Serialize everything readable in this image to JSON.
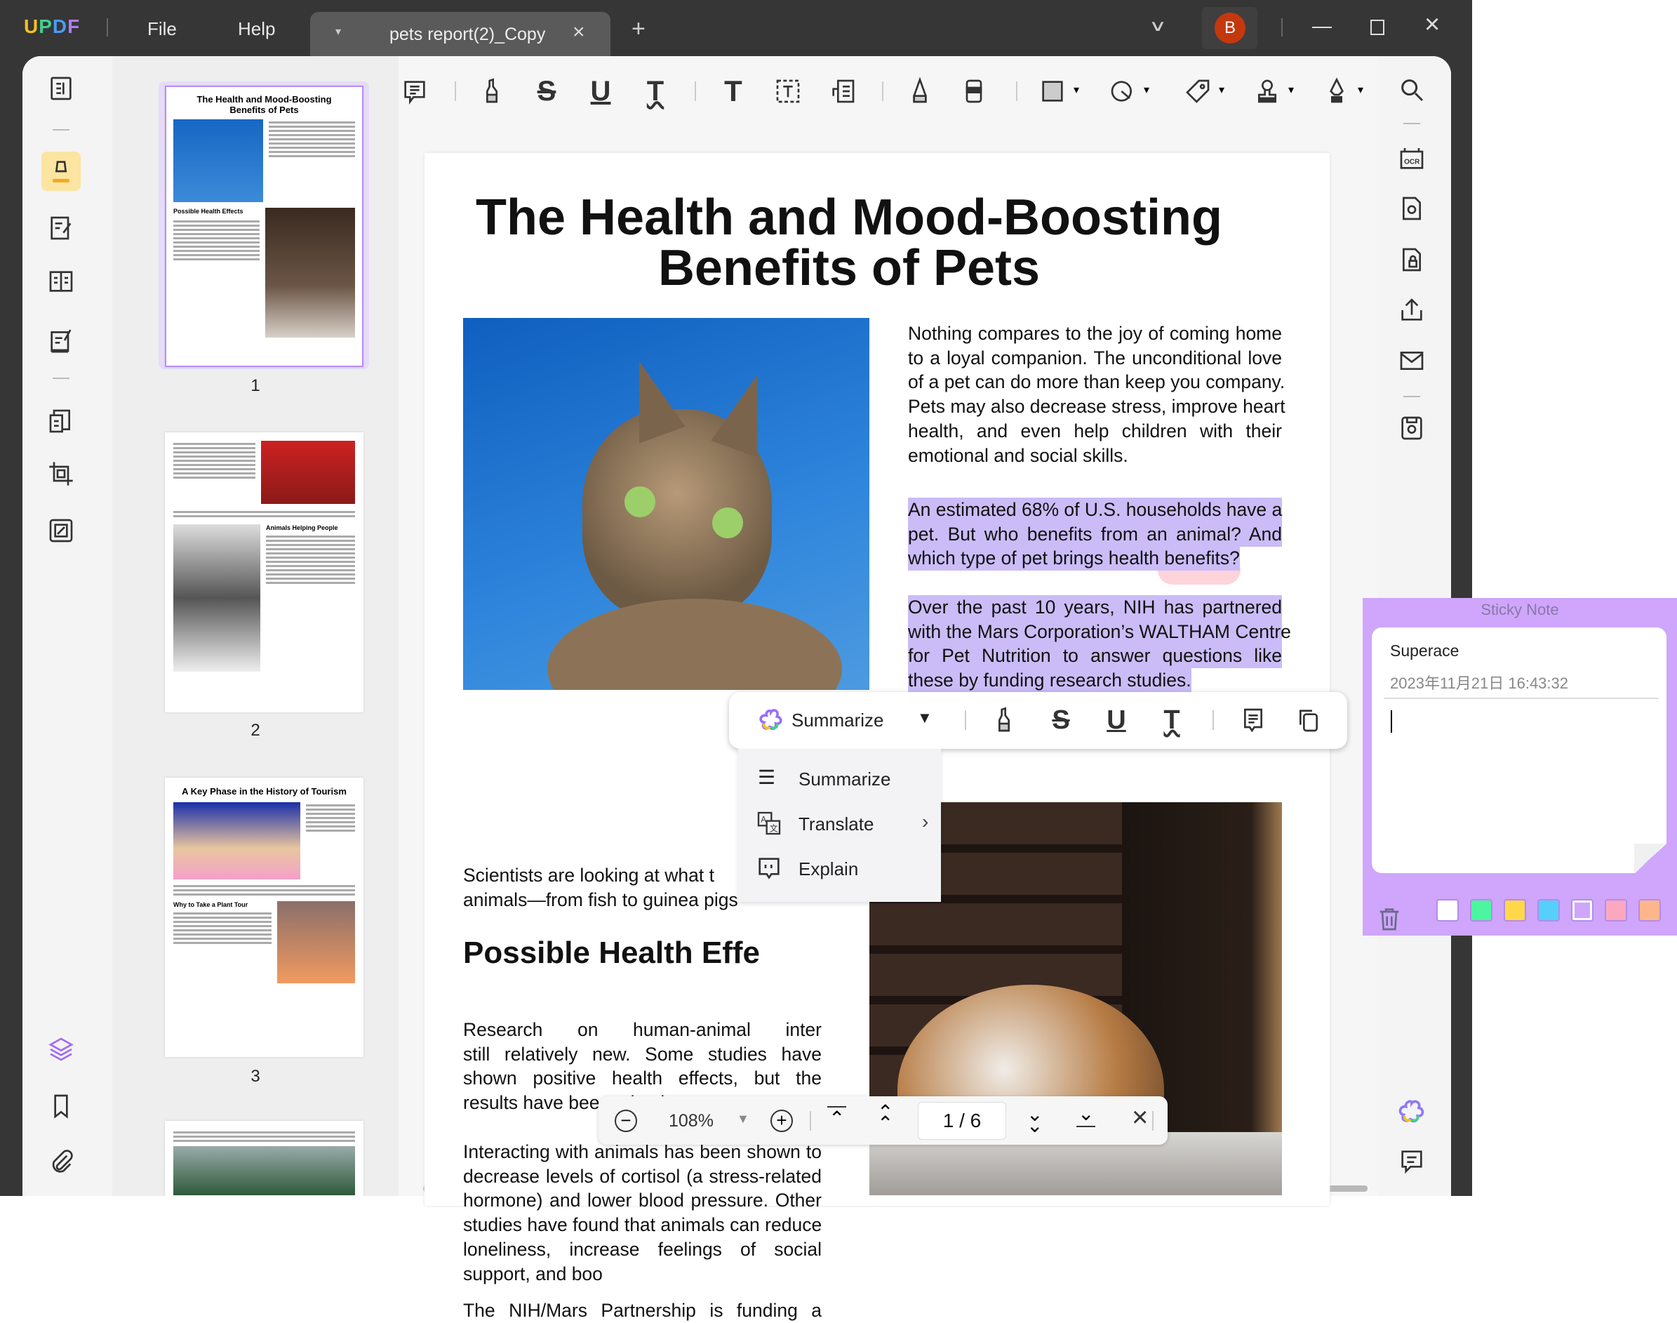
{
  "titlebar": {
    "logo": "UPDF",
    "menu_file": "File",
    "menu_help": "Help",
    "tab_title": "pets report(2)_Copy",
    "avatar_initial": "B"
  },
  "colors": {
    "accent": "#a06bf5",
    "highlight": "#cbbcf7",
    "sticky_bg": "#cfa6fb",
    "avatar": "#c4380e"
  },
  "thumbnails": [
    {
      "page": "1",
      "title": "The Health and Mood-Boosting Benefits of Pets",
      "subtitle": "Possible Health Effects"
    },
    {
      "page": "2",
      "subtitle": "Animals Helping People"
    },
    {
      "page": "3",
      "title": "A Key Phase in the History of Tourism",
      "subtitle": "Why to Take a Plant Tour"
    }
  ],
  "doc": {
    "title_line1": "The Health and Mood-Boosting",
    "title_line2": "Benefits of Pets",
    "intro_lines": [
      "Nothing compares to the joy of coming home",
      "to a loyal companion. The unconditional love",
      "of a pet can do more than keep you company.",
      "Pets may also decrease stress, improve heart",
      "health, and even help children with their",
      "emotional and social skills."
    ],
    "hl1_lines": [
      "An estimated 68% of U.S. households have a",
      "pet. But who benefits from an animal? And",
      "which type of pet brings health benefits?"
    ],
    "hl2_lines": [
      "Over the past 10 years, NIH has partnered",
      "with the Mars Corporation’s WALTHAM Centre",
      "for Pet Nutrition to answer questions like",
      "these by funding research studies."
    ],
    "sci_lines": [
      "Scientists are looking at what t",
      "animals—from fish to guinea pigs"
    ],
    "heading": "Possible Health Effe",
    "research_lines": [
      "Research on human-animal inter",
      "still relatively new. Some studies have",
      "shown positive health effects, but the",
      "results have been mixed."
    ],
    "interact_lines": [
      "Interacting with animals has been shown to",
      "decrease levels of cortisol (a stress-related",
      "hormone) and lower blood pressure. Other",
      "studies have found that animals can reduce",
      "loneliness, increase feelings of social",
      "support, and boo"
    ],
    "nih_line": "The NIH/Mars Partnership is funding a"
  },
  "popup": {
    "ai_label": "Summarize",
    "menu": [
      {
        "label": "Summarize"
      },
      {
        "label": "Translate"
      },
      {
        "label": "Explain"
      }
    ]
  },
  "navbar": {
    "zoom": "108%",
    "page": "1 / 6"
  },
  "sticky": {
    "header": "Sticky Note",
    "author": "Superace",
    "timestamp": "2023年11月21日 16:43:32",
    "swatches": [
      "#ffffff",
      "#4cf5a0",
      "#ffd84a",
      "#55d0fb",
      "#cfa6fb",
      "#fca8c0",
      "#fdb68c"
    ]
  }
}
